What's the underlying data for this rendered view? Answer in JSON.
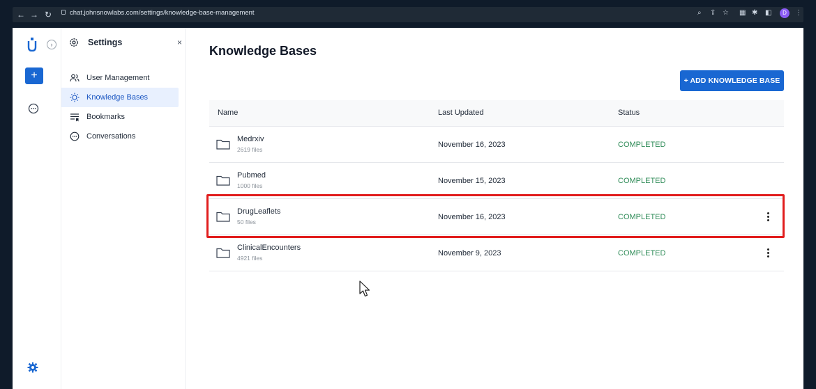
{
  "browser": {
    "url": "chat.johnsnowlabs.com/settings/knowledge-base-management",
    "back_icon": "arrow-left-icon",
    "forward_icon": "arrow-right-icon",
    "reload_icon": "reload-icon",
    "profile_initial": "D"
  },
  "rail": {
    "new_label": "+"
  },
  "settings_panel": {
    "title": "Settings",
    "close_label": "×",
    "items": [
      {
        "label": "User Management",
        "icon": "users-icon"
      },
      {
        "label": "Knowledge Bases",
        "icon": "bulb-icon",
        "active": true
      },
      {
        "label": "Bookmarks",
        "icon": "bookmarks-icon"
      },
      {
        "label": "Conversations",
        "icon": "chat-icon"
      }
    ]
  },
  "main": {
    "title": "Knowledge Bases",
    "add_button": "+ ADD KNOWLEDGE BASE",
    "columns": [
      "Name",
      "Last Updated",
      "Status"
    ],
    "rows": [
      {
        "name": "Medrxiv",
        "files": "2619 files",
        "date": "November 16, 2023",
        "status": "COMPLETED",
        "menu": false
      },
      {
        "name": "Pubmed",
        "files": "1000 files",
        "date": "November 15, 2023",
        "status": "COMPLETED",
        "menu": false
      },
      {
        "name": "DrugLeaflets",
        "files": "50 files",
        "date": "November 16, 2023",
        "status": "COMPLETED",
        "menu": true
      },
      {
        "name": "ClinicalEncounters",
        "files": "4921 files",
        "date": "November 9, 2023",
        "status": "COMPLETED",
        "menu": true
      }
    ]
  },
  "colors": {
    "accent": "#1967d2",
    "status_completed": "#2e8b57",
    "highlight": "#e11d1d"
  }
}
